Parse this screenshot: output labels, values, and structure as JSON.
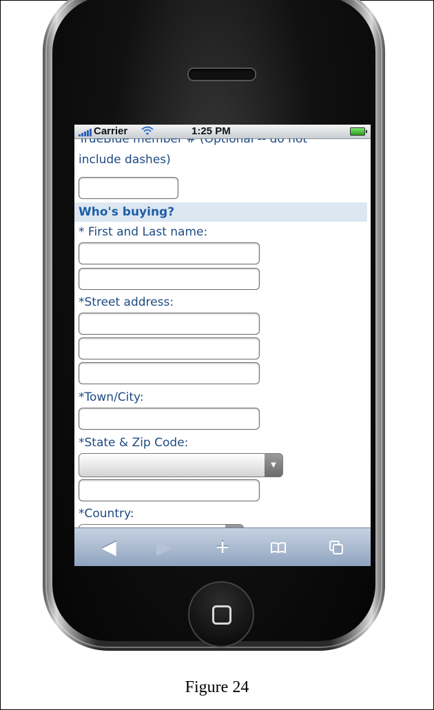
{
  "figure": {
    "caption": "Figure 24"
  },
  "status_bar": {
    "carrier": "Carrier",
    "time": "1:25 PM"
  },
  "form": {
    "member_label_line1": "TrueBlue member # (Optional -- do not",
    "member_label_line2": "include dashes)",
    "section_heading": "Who's buying?",
    "name_label": "* First and Last name:",
    "street_label": "*Street address:",
    "town_label": "*Town/City:",
    "state_zip_label": "*State  & Zip Code:",
    "country_label": "*Country:"
  },
  "toolbar": {
    "icons": [
      "back-icon",
      "forward-icon",
      "add-bookmark-icon",
      "bookmarks-icon",
      "pages-icon"
    ]
  }
}
